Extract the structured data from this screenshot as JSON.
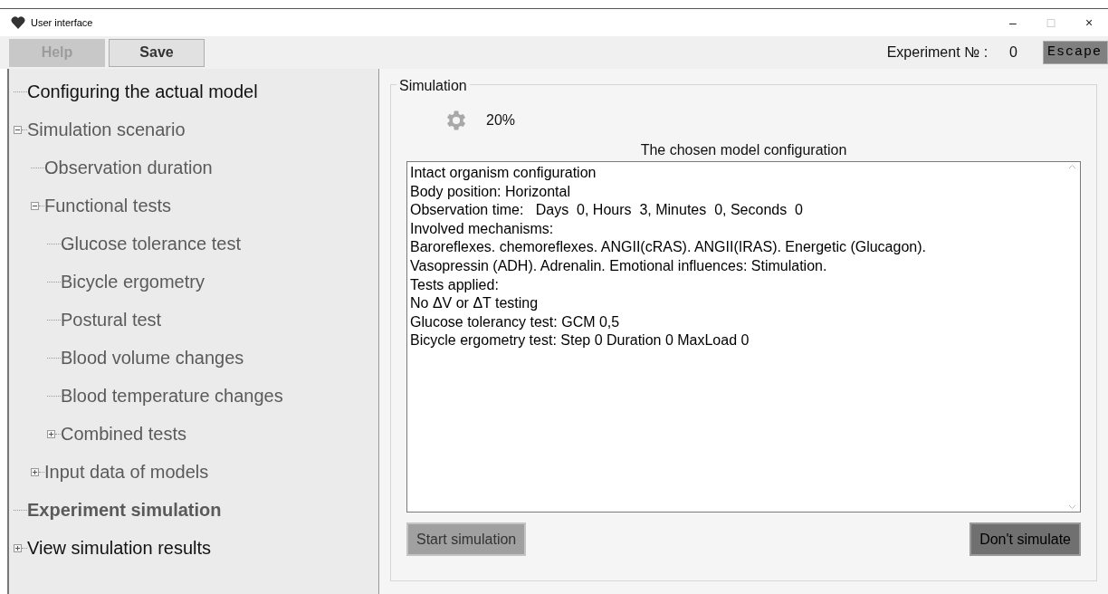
{
  "window": {
    "title": "User interface",
    "controls": [
      "–",
      "□",
      "×"
    ]
  },
  "toolbar": {
    "buttons": [
      {
        "label": "Help",
        "disabled": true
      },
      {
        "label": "Save",
        "disabled": false
      }
    ],
    "experiment_label": "Experiment № :",
    "experiment_number": "0",
    "escape_button": "Escape"
  },
  "tree": [
    {
      "label": "Configuring the actual model",
      "disabled": false,
      "selected": false
    },
    {
      "label": "Simulation scenario",
      "disabled": true,
      "selected": false,
      "expanded": true,
      "children": [
        {
          "label": "Observation duration",
          "disabled": true,
          "selected": false
        },
        {
          "label": "Functional tests",
          "disabled": true,
          "selected": false,
          "expanded": true,
          "children": [
            {
              "label": "Glucose tolerance test",
              "disabled": true,
              "selected": false
            },
            {
              "label": "Bicycle ergometry",
              "disabled": true,
              "selected": false
            },
            {
              "label": "Postural test",
              "disabled": true,
              "selected": false
            },
            {
              "label": "Blood volume changes",
              "disabled": true,
              "selected": false
            },
            {
              "label": "Blood temperature changes",
              "disabled": true,
              "selected": false
            },
            {
              "label": "Combined tests",
              "disabled": true,
              "selected": false,
              "expanded": false
            }
          ]
        },
        {
          "label": "Input data of models",
          "disabled": true,
          "selected": false,
          "expanded": false
        }
      ]
    },
    {
      "label": "Experiment simulation",
      "disabled": true,
      "selected": true
    },
    {
      "label": "View simulation results",
      "disabled": false,
      "selected": false,
      "expanded": false
    }
  ],
  "simulation": {
    "group_title": "Simulation",
    "progress_text": "20%",
    "config_title": "The chosen model configuration",
    "config_lines": [
      "Intact organism configuration",
      "Body position: Horizontal",
      "Observation time:   Days  0, Hours  3, Minutes  0, Seconds  0",
      "Involved mechanisms:",
      "Baroreflexes. chemoreflexes. ANGII(cRAS). ANGII(IRAS). Energetic (Glucagon).",
      "Vasopressin (ADH). Adrenalin. Emotional influences: Stimulation.",
      "Tests applied:",
      "No ΔV or ΔT testing",
      "Glucose tolerancy test: GCM 0,5",
      "Bicycle ergometry test: Step 0 Duration 0 MaxLoad 0"
    ],
    "buttons": [
      {
        "label": "Start simulation",
        "kind": "start"
      },
      {
        "label": "Don't simulate",
        "kind": "cancel"
      }
    ]
  }
}
